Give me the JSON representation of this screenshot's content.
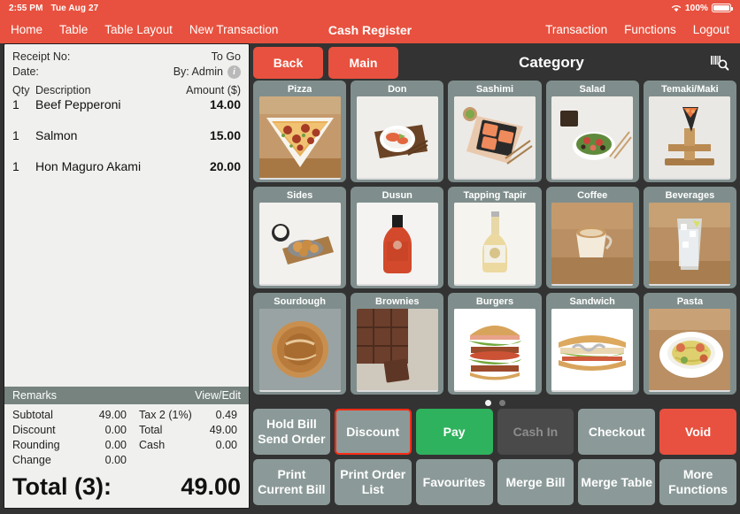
{
  "statusbar": {
    "time": "2:55 PM",
    "date": "Tue Aug 27",
    "battery_percent": "100%",
    "wifi_icon": "wifi-icon",
    "battery_icon": "battery-icon"
  },
  "nav": {
    "title": "Cash Register",
    "left_items": [
      {
        "label": "Home",
        "name": "nav-home"
      },
      {
        "label": "Table",
        "name": "nav-table"
      },
      {
        "label": "Table Layout",
        "name": "nav-table-layout"
      },
      {
        "label": "New Transaction",
        "name": "nav-new-transaction"
      }
    ],
    "right_items": [
      {
        "label": "Transaction",
        "name": "nav-transaction"
      },
      {
        "label": "Functions",
        "name": "nav-functions"
      },
      {
        "label": "Logout",
        "name": "nav-logout"
      }
    ]
  },
  "receipt": {
    "receipt_no_label": "Receipt No:",
    "receipt_no_value": "To Go",
    "date_label": "Date:",
    "by_value": "By: Admin",
    "info_icon": "info-icon",
    "columns": {
      "qty": "Qty",
      "description": "Description",
      "amount": "Amount ($)"
    },
    "items": [
      {
        "qty": "1",
        "description": "Beef Pepperoni",
        "amount": "14.00"
      },
      {
        "qty": "1",
        "description": "Salmon",
        "amount": "15.00"
      },
      {
        "qty": "1",
        "description": "Hon Maguro Akami",
        "amount": "20.00"
      }
    ],
    "remarks_label": "Remarks",
    "view_edit_label": "View/Edit",
    "totals_left": [
      {
        "label": "Subtotal",
        "value": "49.00"
      },
      {
        "label": "Discount",
        "value": "0.00"
      },
      {
        "label": "Rounding",
        "value": "0.00"
      },
      {
        "label": "Change",
        "value": "0.00"
      }
    ],
    "totals_right": [
      {
        "label": "Tax 2 (1%)",
        "value": "0.49"
      },
      {
        "label": "Total",
        "value": "49.00"
      },
      {
        "label": "Cash",
        "value": "0.00"
      }
    ],
    "grand_label": "Total (3):",
    "grand_value": "49.00"
  },
  "category_bar": {
    "back_label": "Back",
    "main_label": "Main",
    "title": "Category",
    "search_icon": "barcode-search-icon"
  },
  "categories": [
    {
      "label": "Pizza",
      "name": "category-tile-pizza",
      "art": "pizza"
    },
    {
      "label": "Don",
      "name": "category-tile-don",
      "art": "don"
    },
    {
      "label": "Sashimi",
      "name": "category-tile-sashimi",
      "art": "sashimi"
    },
    {
      "label": "Salad",
      "name": "category-tile-salad",
      "art": "salad"
    },
    {
      "label": "Temaki/Maki",
      "name": "category-tile-temaki-maki",
      "art": "temaki"
    },
    {
      "label": "Sides",
      "name": "category-tile-sides",
      "art": "sides"
    },
    {
      "label": "Dusun",
      "name": "category-tile-dusun",
      "art": "dusun"
    },
    {
      "label": "Tapping Tapir",
      "name": "category-tile-tapping-tapir",
      "art": "tapir"
    },
    {
      "label": "Coffee",
      "name": "category-tile-coffee",
      "art": "coffee"
    },
    {
      "label": "Beverages",
      "name": "category-tile-beverages",
      "art": "beverages"
    },
    {
      "label": "Sourdough",
      "name": "category-tile-sourdough",
      "art": "sourdough"
    },
    {
      "label": "Brownies",
      "name": "category-tile-brownies",
      "art": "brownies"
    },
    {
      "label": "Burgers",
      "name": "category-tile-burgers",
      "art": "burgers"
    },
    {
      "label": "Sandwich",
      "name": "category-tile-sandwich",
      "art": "sandwich"
    },
    {
      "label": "Pasta",
      "name": "category-tile-pasta",
      "art": "pasta"
    }
  ],
  "pager": {
    "total": 2,
    "active": 1
  },
  "actions": [
    {
      "label": "Hold Bill\nSend Order",
      "name": "hold-bill-send-order-button",
      "style": ""
    },
    {
      "label": "Discount",
      "name": "discount-button",
      "style": "selected"
    },
    {
      "label": "Pay",
      "name": "pay-button",
      "style": "green"
    },
    {
      "label": "Cash In",
      "name": "cash-in-button",
      "style": "disabled"
    },
    {
      "label": "Checkout",
      "name": "checkout-button",
      "style": ""
    },
    {
      "label": "Void",
      "name": "void-button",
      "style": "red"
    },
    {
      "label": "Print\nCurrent Bill",
      "name": "print-current-bill-button",
      "style": ""
    },
    {
      "label": "Print Order\nList",
      "name": "print-order-list-button",
      "style": ""
    },
    {
      "label": "Favourites",
      "name": "favourites-button",
      "style": ""
    },
    {
      "label": "Merge Bill",
      "name": "merge-bill-button",
      "style": ""
    },
    {
      "label": "Merge Table",
      "name": "merge-table-button",
      "style": ""
    },
    {
      "label": "More\nFunctions",
      "name": "more-functions-button",
      "style": ""
    }
  ],
  "colors": {
    "brand_red": "#e8513f",
    "tile_gray": "#7f8e8c",
    "action_gray": "#8b9a98",
    "pay_green": "#2fb25d",
    "panel_dark": "#333333",
    "receipt_bg": "#f0f0ee",
    "remarks_bar": "#76837f"
  }
}
